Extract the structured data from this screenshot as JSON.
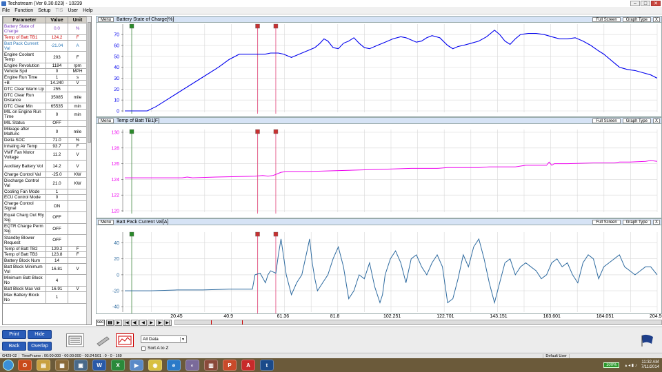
{
  "window": {
    "title": "Techstream (Ver 8.30.023) - 10239"
  },
  "menu": [
    "File",
    "Function",
    "Setup",
    "TIS",
    "User",
    "Help"
  ],
  "params": {
    "headers": [
      "Parameter",
      "Value",
      "Unit"
    ],
    "rows": [
      [
        "Battery State of Charge",
        "0.0",
        "%"
      ],
      [
        "Temp of Batt TB1",
        "124.2",
        "F"
      ],
      [
        "Batt Pack Current Val",
        "-21.04",
        "A"
      ],
      [
        "Engine Coolant Temp",
        "203",
        "F"
      ],
      [
        "Engine Revolution",
        "1184",
        "rpm"
      ],
      [
        "Vehicle Spd",
        "0",
        "MPH"
      ],
      [
        "Engine Run Time",
        "1",
        "s"
      ],
      [
        "+B",
        "14.240",
        "V"
      ],
      [
        "DTC Clear Warm Up",
        "255",
        ""
      ],
      [
        "DTC Clear Run Distance",
        "35085",
        "mile"
      ],
      [
        "DTC Clear Min",
        "65535",
        "min"
      ],
      [
        "MIL on Engine Run Time",
        "0",
        "min"
      ],
      [
        "MIL Status",
        "OFF",
        ""
      ],
      [
        "Mileage after Malfunc",
        "0",
        "mile"
      ],
      [
        "Delta SOC",
        "71.0",
        "%"
      ],
      [
        "Inhaling Air Temp",
        "93.7",
        "F"
      ],
      [
        "VMF Fan Motor Voltage",
        "11.2",
        "V"
      ],
      [
        "Auxiliary Battery Vol",
        "14.2",
        "V"
      ],
      [
        "Charge Control Val",
        "-25.0",
        "KW"
      ],
      [
        "Discharge Control Val",
        "21.0",
        "KW"
      ],
      [
        "Cooling Fan Mode",
        "1",
        ""
      ],
      [
        "ECU Control Mode",
        "0",
        ""
      ],
      [
        "Charge Control Signal",
        "ON",
        ""
      ],
      [
        "Equal Charg Out Rly Sig",
        "OFF",
        ""
      ],
      [
        "EQTR Charge Perm Sig",
        "OFF",
        ""
      ],
      [
        "Standby Blower Request",
        "OFF",
        ""
      ],
      [
        "Temp of Batt TB2",
        "129.2",
        "F"
      ],
      [
        "Temp of Batt TB3",
        "123.8",
        "F"
      ],
      [
        "Battery Block Num",
        "14",
        ""
      ],
      [
        "Batt Block Minimum Vol",
        "16.81",
        "V"
      ],
      [
        "Minimum Batt Block No",
        "4",
        ""
      ],
      [
        "Batt Block Max Vol",
        "16.91",
        "V"
      ],
      [
        "Max Battery Block No",
        "1",
        ""
      ]
    ]
  },
  "graphs": {
    "menu_label": "Menu",
    "full_screen_label": "Full Screen",
    "graph_type_label": "Graph Type",
    "close_label": "X",
    "panels": [
      {
        "title": "Battery State of Charge[%]",
        "color": "#0000ee"
      },
      {
        "title": "Temp of Batt TB1[F]",
        "color": "#ee00ee"
      },
      {
        "title": "Batt Pack Current Val[A]",
        "color": "#2d6a9f"
      }
    ]
  },
  "chart_data": [
    {
      "type": "line",
      "title": "Battery State of Charge[%]",
      "xlim": [
        0,
        204.501
      ],
      "ylim": [
        0,
        77
      ],
      "yticks": [
        0,
        10,
        20,
        30,
        40,
        50,
        60,
        70
      ],
      "series": [
        {
          "x": [
            0,
            3,
            6,
            8.6,
            12,
            16,
            20,
            24,
            28,
            32,
            36,
            40,
            44,
            48.5,
            51,
            52,
            54,
            56,
            57.5,
            59,
            61,
            64,
            67,
            70,
            73,
            75,
            76.5,
            78,
            80,
            82,
            84,
            86,
            88,
            90,
            92,
            94,
            97,
            100,
            103,
            106,
            108,
            110,
            112,
            114,
            116,
            118,
            121,
            124,
            126,
            128,
            130,
            133,
            136,
            139,
            142,
            144,
            146,
            148,
            150,
            152,
            155,
            158,
            161,
            164,
            167,
            170,
            173,
            176,
            179,
            182,
            184,
            187,
            190,
            193,
            196,
            199,
            202,
            204.5
          ],
          "y": [
            0,
            0,
            0,
            0,
            4,
            10,
            16,
            22,
            28,
            34,
            40,
            47,
            52,
            52,
            52,
            52,
            52,
            53,
            53,
            53,
            52,
            49,
            52,
            55,
            58,
            62,
            66,
            64,
            58,
            57,
            62,
            64,
            67,
            62,
            58,
            57,
            60,
            63,
            66,
            68,
            67,
            65,
            63,
            64,
            67,
            69,
            67,
            60,
            57,
            59,
            60,
            62,
            64,
            68,
            74,
            70,
            64,
            61,
            66,
            70,
            71,
            71,
            70,
            68,
            66,
            66,
            67,
            64,
            60,
            55,
            52,
            46,
            40,
            38,
            37,
            35,
            33,
            30
          ]
        }
      ]
    },
    {
      "type": "line",
      "title": "Temp of Batt TB1[F]",
      "xlim": [
        0,
        204.501
      ],
      "ylim": [
        120,
        130
      ],
      "yticks": [
        120,
        122,
        124,
        126,
        128,
        130
      ],
      "series": [
        {
          "x": [
            0,
            12,
            22,
            24,
            26,
            35,
            50,
            53,
            55,
            57,
            60,
            62,
            70,
            80,
            90,
            100,
            110,
            120,
            124,
            130,
            136,
            140,
            150,
            154,
            162,
            163,
            164,
            165,
            170,
            180,
            188,
            190,
            194,
            200,
            202,
            204.5
          ],
          "y": [
            124.2,
            124.2,
            124.2,
            124.3,
            124.2,
            124.3,
            124.4,
            124.5,
            124.4,
            124.5,
            124.9,
            125.0,
            125.0,
            125.1,
            125.2,
            125.3,
            125.4,
            125.4,
            125.5,
            125.5,
            125.5,
            125.6,
            125.6,
            125.8,
            125.8,
            126.2,
            125.8,
            126.0,
            126.0,
            126.1,
            126.1,
            126.2,
            126.2,
            126.3,
            126.4,
            126.3
          ]
        }
      ]
    },
    {
      "type": "line",
      "title": "Batt Pack Current Val[A]",
      "xlim": [
        0,
        204.501
      ],
      "ylim": [
        -45,
        50
      ],
      "yticks": [
        -40,
        -20,
        0,
        20,
        40
      ],
      "series": [
        {
          "x": [
            0,
            10,
            20,
            30,
            40,
            49,
            50,
            52,
            54,
            55,
            56,
            58,
            59,
            60,
            62,
            64,
            66,
            68,
            70,
            71,
            72,
            73,
            74,
            76,
            78,
            80,
            82,
            84,
            85,
            86,
            88,
            90,
            92,
            94,
            96,
            98,
            99,
            100,
            102,
            104,
            106,
            108,
            110,
            112,
            114,
            116,
            118,
            120,
            122,
            124,
            126,
            128,
            130,
            132,
            134,
            136,
            138,
            140,
            142,
            144,
            146,
            148,
            150,
            152,
            154,
            156,
            158,
            160,
            162,
            164,
            166,
            168,
            170,
            172,
            174,
            176,
            178,
            180,
            182,
            184,
            186,
            188,
            190,
            192,
            194,
            196,
            198,
            200,
            202,
            204.5
          ],
          "y": [
            -20,
            -20,
            -19,
            -19,
            -18,
            -18,
            0,
            2,
            -10,
            0,
            5,
            2,
            25,
            45,
            0,
            -25,
            -10,
            0,
            30,
            45,
            15,
            -5,
            -20,
            -10,
            0,
            20,
            35,
            10,
            -10,
            -30,
            -20,
            0,
            -5,
            15,
            -15,
            -35,
            -25,
            0,
            20,
            30,
            15,
            -10,
            20,
            25,
            10,
            0,
            15,
            25,
            10,
            -35,
            -30,
            -5,
            25,
            10,
            35,
            45,
            20,
            -10,
            -35,
            -10,
            15,
            20,
            0,
            10,
            15,
            10,
            5,
            -5,
            0,
            15,
            20,
            10,
            15,
            0,
            -10,
            15,
            25,
            20,
            -5,
            10,
            15,
            20,
            25,
            10,
            5,
            0,
            5,
            10,
            10,
            0
          ]
        }
      ]
    }
  ],
  "time_axis": {
    "labels": [
      "20.45",
      "40.9",
      "61.36",
      "81.8",
      "102.251",
      "122.701",
      "143.151",
      "163.601",
      "184.051",
      "204.501"
    ],
    "markers": [
      0,
      51,
      58
    ]
  },
  "playbar": {
    "unit_label": "[sec]",
    "buttons": [
      "▮▮",
      "▶",
      "|◀",
      "◀|",
      "◀",
      "▶",
      "|▶",
      "▶|"
    ]
  },
  "bottom": {
    "print": "Print",
    "hide": "Hide",
    "back": "Back",
    "overlap": "Overlap",
    "dropdown_value": "All Data",
    "sort_label": "Sort A to Z"
  },
  "status": {
    "left": "G429-02",
    "timeframe": "TimeFrame : 00:00:000 - 00:00:000 - 03:24:501 : 0 - 0 - 169",
    "mode": "Default User"
  },
  "taskbar": {
    "battery": "100%",
    "time": "11:32 AM",
    "date": "7/11/2014"
  }
}
